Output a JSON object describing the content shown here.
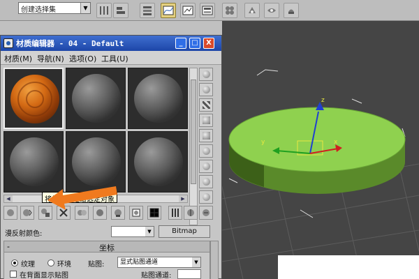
{
  "toolbar": {
    "selection_set_value": "创建选择集",
    "icons": [
      "mirror-icon",
      "align-icon",
      "layer-manager-icon",
      "curve-editor-icon",
      "schematic-view-icon",
      "material-editor-icon",
      "render-setup-icon",
      "render-frame-icon",
      "quick-render-icon"
    ]
  },
  "material_editor": {
    "title": "材质编辑器 - 04 - Default",
    "window_buttons": {
      "minimize": "_",
      "maximize": "□",
      "close": "X"
    },
    "menu": [
      "材质(M)",
      "导航(N)",
      "选项(O)",
      "工具(U)"
    ],
    "slots": [
      {
        "material": "wood-orange",
        "selected": true
      },
      {
        "material": "default-gray",
        "selected": false
      },
      {
        "material": "default-gray",
        "selected": false
      },
      {
        "material": "default-gray",
        "selected": false
      },
      {
        "material": "default-gray",
        "selected": false
      },
      {
        "material": "default-gray",
        "selected": false
      }
    ],
    "tooltip": "将材质指定给选定对象",
    "diffuse_label": "漫反射颜色:",
    "bitmap_label": "Bitmap",
    "rollout": {
      "title": "坐标",
      "minus": "-",
      "radio_texture": "纹理",
      "radio_env": "环境",
      "map_label": "贴图:",
      "map_value": "显式贴图通道",
      "show_map_check": "在背面显示贴图",
      "map_channel_label": "贴图通道:"
    }
  },
  "colors": {
    "title_bar": "#1d46a8",
    "arrow": "#f07a1e",
    "viewport_bg": "#454545",
    "cylinder_top": "#8fd14f",
    "cylinder_side": "#5a8a2a",
    "gizmo_x": "#d02020",
    "gizmo_y": "#20a020",
    "gizmo_z": "#2040d0"
  },
  "viewport": {
    "object": "cylinder",
    "gizmo_labels": {
      "x": "x",
      "y": "y",
      "z": "z"
    }
  }
}
